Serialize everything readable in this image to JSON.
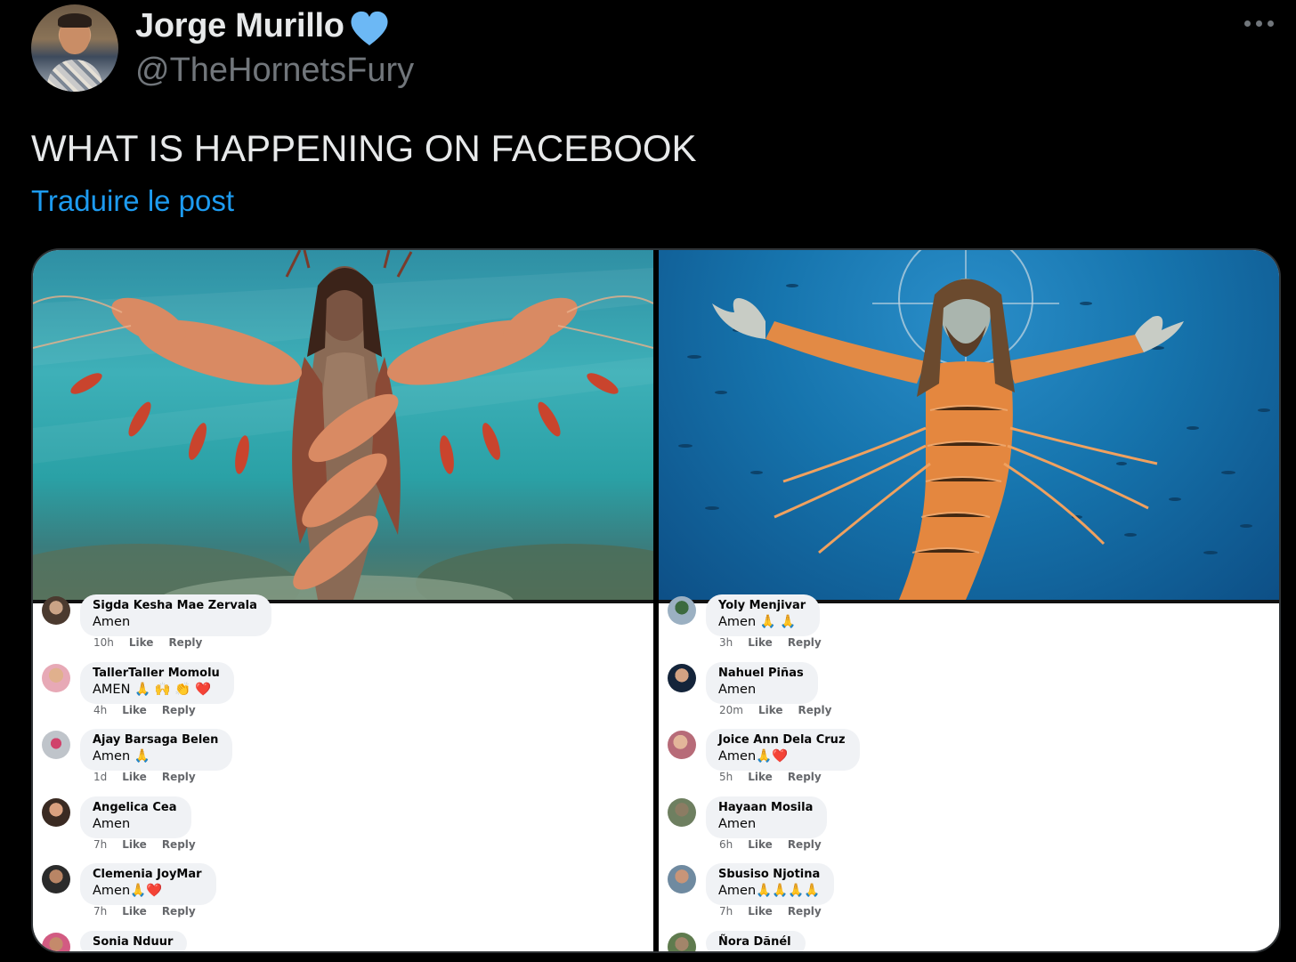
{
  "author": {
    "name": "Jorge Murillo",
    "handle": "@TheHornetsFury"
  },
  "tweet": {
    "text": "WHAT IS HAPPENING ON FACEBOOK",
    "translate_label": "Traduire le post"
  },
  "icons": {
    "verified": "verified-heart-icon",
    "more": "more-options-icon"
  },
  "colors": {
    "background": "#000000",
    "accent": "#1d9bf0",
    "verified": "#6cb8f5"
  },
  "comments_left": [
    {
      "name": "Sigda Kesha Mae Zervala",
      "text": "Amen",
      "time": "10h",
      "like": "Like",
      "reply": "Reply"
    },
    {
      "name": "TallerTaller Momolu",
      "text": "AMEN 🙏 🙌 👏 ❤️",
      "time": "4h",
      "like": "Like",
      "reply": "Reply"
    },
    {
      "name": "Ajay Barsaga Belen",
      "text": "Amen 🙏",
      "time": "1d",
      "like": "Like",
      "reply": "Reply"
    },
    {
      "name": "Angelica Cea",
      "text": "Amen",
      "time": "7h",
      "like": "Like",
      "reply": "Reply"
    },
    {
      "name": "Clemenia JoyMar",
      "text": "Amen🙏❤️",
      "time": "7h",
      "like": "Like",
      "reply": "Reply"
    },
    {
      "name": "Sonia Nduur",
      "text": "",
      "time": "",
      "like": "",
      "reply": ""
    }
  ],
  "comments_right": [
    {
      "name": "Yoly Menjivar",
      "text": "Amen 🙏 🙏",
      "time": "3h",
      "like": "Like",
      "reply": "Reply"
    },
    {
      "name": "Nahuel Piñas",
      "text": "Amen",
      "time": "20m",
      "like": "Like",
      "reply": "Reply"
    },
    {
      "name": "Joice Ann Dela Cruz",
      "text": "Amen🙏❤️",
      "time": "5h",
      "like": "Like",
      "reply": "Reply"
    },
    {
      "name": "Hayaan Mosila",
      "text": "Amen",
      "time": "6h",
      "like": "Like",
      "reply": "Reply"
    },
    {
      "name": "Sbusiso Njotina",
      "text": "Amen🙏🙏🙏🙏",
      "time": "7h",
      "like": "Like",
      "reply": "Reply"
    },
    {
      "name": "Ñora Dãnél",
      "text": "",
      "time": "",
      "like": "",
      "reply": ""
    }
  ]
}
